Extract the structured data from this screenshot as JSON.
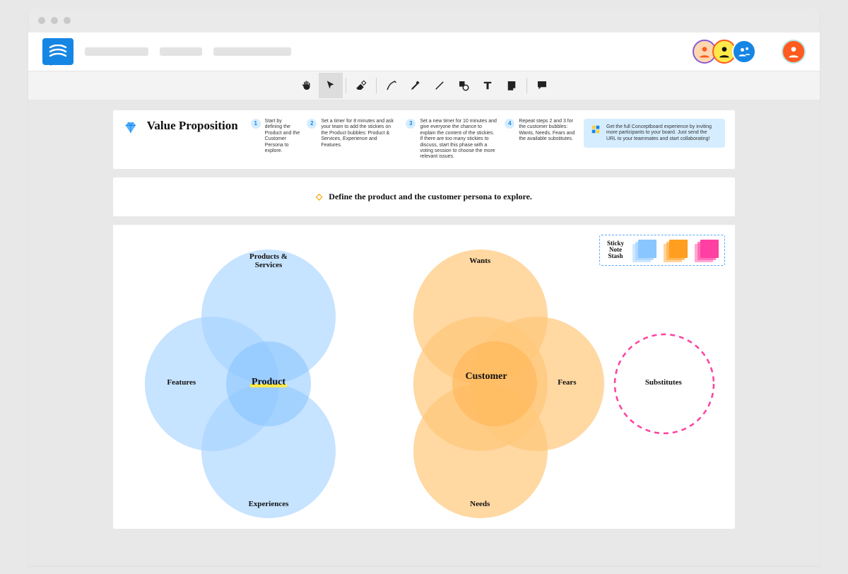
{
  "toolbar": {
    "tools": [
      "hand",
      "pointer",
      "eraser",
      "pen",
      "marker",
      "line",
      "shape",
      "text",
      "note",
      "comment"
    ],
    "active": "pointer"
  },
  "header": {
    "title": "Value Proposition",
    "steps": [
      {
        "num": "1",
        "text": "Start by defining the Product and the Customer Persona to explore."
      },
      {
        "num": "2",
        "text": "Set a timer for 8 minutes and ask your team to add the stickies on the Product bubbles: Product & Services, Experience and Features."
      },
      {
        "num": "3",
        "text": "Set a new timer for 10 minutes and give everyone the chance to explain the content of the stickies. If there are too many stickies to discuss, start this phase with a voting session to choose the more relevant issues."
      },
      {
        "num": "4",
        "text": "Repeat steps 2 and 3 for the customer bubbles: Wants, Needs, Fears and the available substitutes."
      }
    ],
    "promo": "Get the full Conceptboard experience by inviting more participants to your board. Just send the URL to your teammates and start collaborating!"
  },
  "tagline": "Define the product and the customer persona to explore.",
  "sticky_stash": {
    "label_line1": "Sticky",
    "label_line2": "Note",
    "label_line3": "Stash"
  },
  "venn": {
    "product": {
      "center": "Product",
      "top": "Products &\nServices",
      "left": "Features",
      "bottom": "Experiences"
    },
    "customer": {
      "center": "Customer",
      "top": "Wants",
      "right": "Fears",
      "bottom": "Needs"
    },
    "substitutes": "Substitutes"
  },
  "chart_data": {
    "type": "diagram",
    "title": "Value Proposition",
    "clusters": [
      {
        "name": "Product",
        "center_label": "Product",
        "petal_labels": [
          "Products & Services",
          "Features",
          "Experiences"
        ],
        "color": "#a7d4ff"
      },
      {
        "name": "Customer",
        "center_label": "Customer",
        "petal_labels": [
          "Wants",
          "Fears",
          "Needs"
        ],
        "color": "#ffc87a"
      }
    ],
    "extra_circle": {
      "label": "Substitutes",
      "style": "dashed",
      "color": "#ff3fa1"
    },
    "sticky_colors": [
      "#89c6ff",
      "#ff9e1f",
      "#ff3fa1"
    ]
  }
}
